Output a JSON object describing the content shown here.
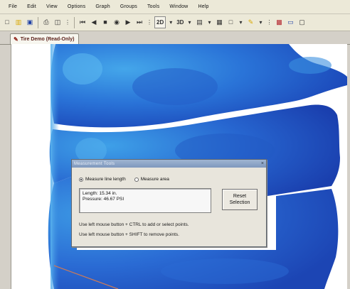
{
  "menu": [
    "File",
    "Edit",
    "View",
    "Options",
    "Graph",
    "Groups",
    "Tools",
    "Window",
    "Help"
  ],
  "toolbar": {
    "view_2d": "2D",
    "view_3d": "3D"
  },
  "tab": {
    "label": "Tire Demo (Read-Only)"
  },
  "dialog": {
    "title": "Measurement Tools",
    "mode_line": "Measure line length",
    "mode_area": "Measure area",
    "selected_mode": "line",
    "result_length": "Length: 15.34 in.",
    "result_pressure": "Pressure: 46.67 PSI",
    "reset_label": "Reset\nSelection",
    "hint_add": "Use left mouse button + CTRL to add or select points.",
    "hint_remove": "Use left mouse button + SHIFT to remove points."
  },
  "colors": {
    "pressure_high": "#3f9be6",
    "pressure_mid": "#2a6fd8",
    "pressure_low": "#1b45b6",
    "measure_line": "#c87a5b"
  }
}
